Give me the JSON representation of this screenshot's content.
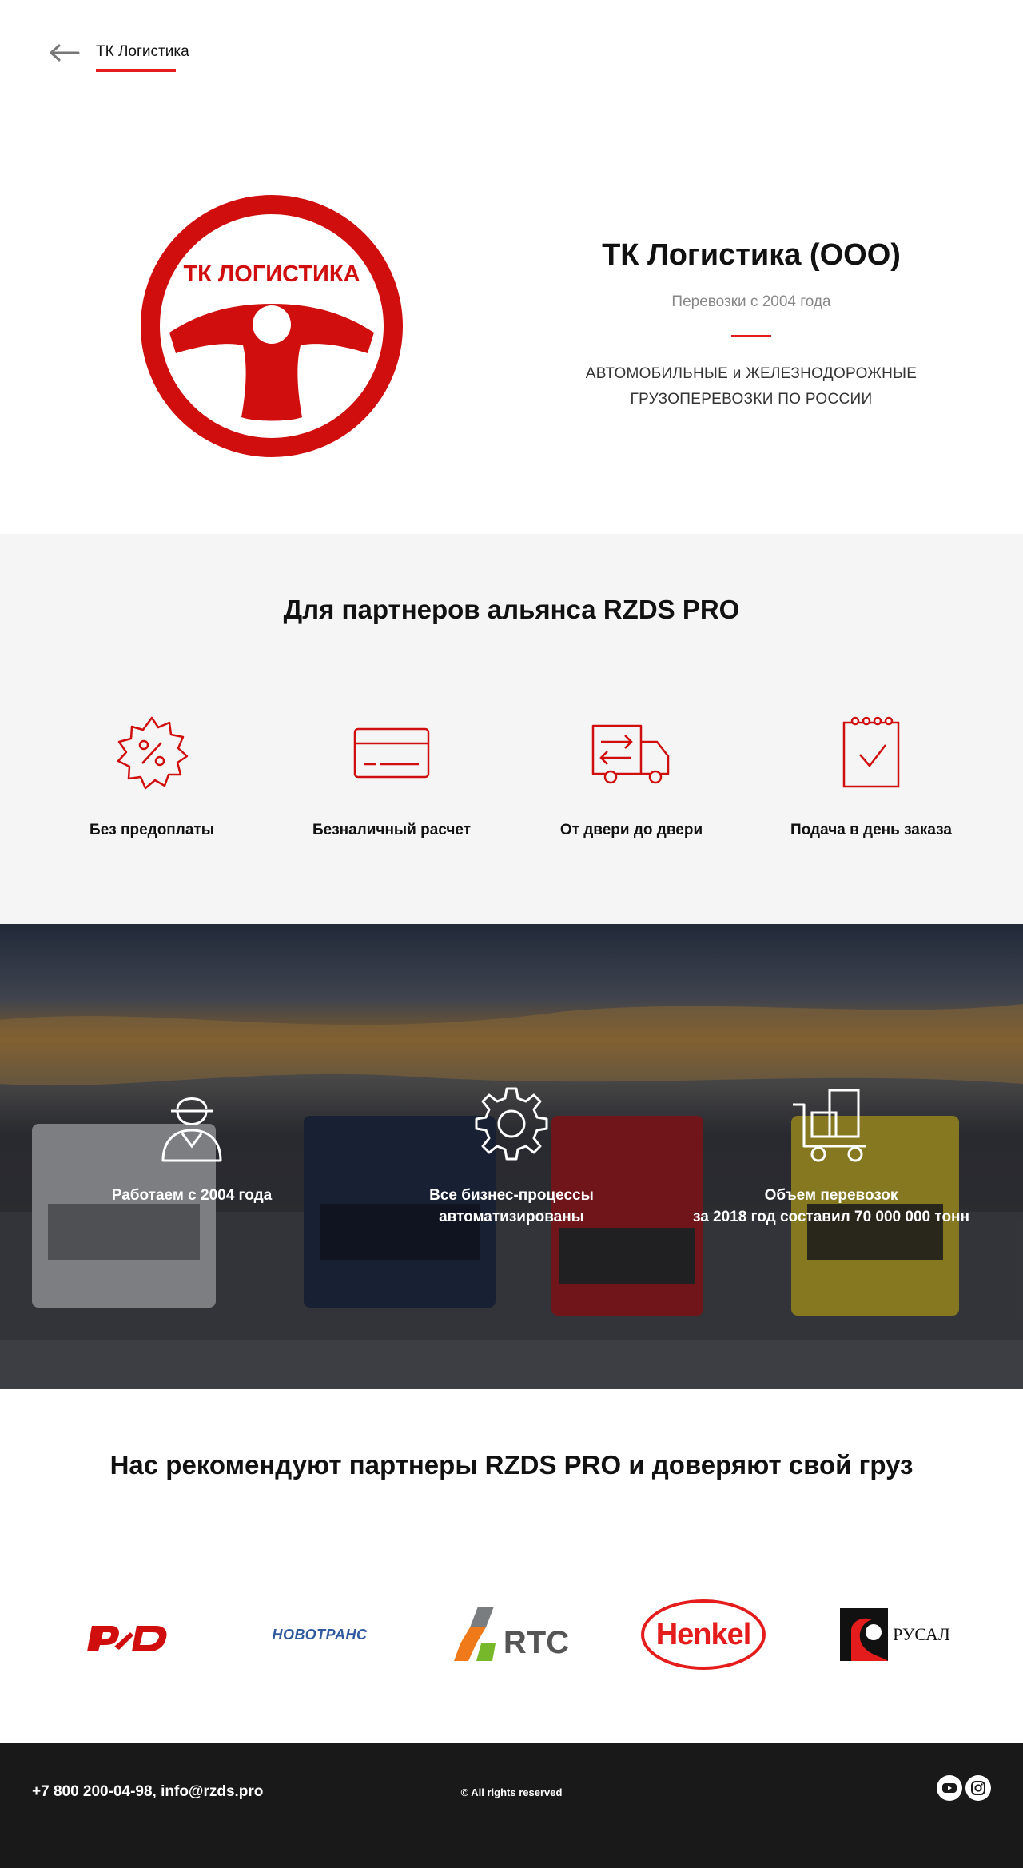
{
  "header": {
    "back_link": "ТК Логистика"
  },
  "hero": {
    "logo_text": "ТК ЛОГИСТИКА",
    "company_name": "ТК Логистика (ООО)",
    "since": "Перевозки с 2004 года",
    "services_line1": "АВТОМОБИЛЬНЫЕ и ЖЕЛЕЗНОДОРОЖНЫЕ",
    "services_line2": "ГРУЗОПЕРЕВОЗКИ ПО РОССИИ"
  },
  "features": {
    "title": "Для партнеров альянса RZDS PRO",
    "items": [
      {
        "label": "Без предоплаты",
        "icon": "discount-badge-icon"
      },
      {
        "label": "Безналичный расчет",
        "icon": "credit-card-icon"
      },
      {
        "label": "От двери до двери",
        "icon": "delivery-truck-icon"
      },
      {
        "label": "Подача в день заказа",
        "icon": "calendar-check-icon"
      }
    ]
  },
  "stats": {
    "items": [
      {
        "line1": "Работаем с 2004 года",
        "line2": "",
        "icon": "worker-icon"
      },
      {
        "line1": "Все бизнес-процессы",
        "line2": "автоматизированы",
        "icon": "gear-icon"
      },
      {
        "line1": "Объем перевозок",
        "line2": "за 2018 год составил 70 000 000 тонн",
        "icon": "cargo-cart-icon"
      }
    ]
  },
  "recommend": {
    "title": "Нас рекомендуют партнеры RZDS PRO и доверяют свой груз",
    "partners": [
      {
        "name": "РЖД",
        "text": ""
      },
      {
        "name": "Новотранс",
        "text": "НОВОТРАНС"
      },
      {
        "name": "RTC",
        "text": "RTC"
      },
      {
        "name": "Henkel",
        "text": "Henkel"
      },
      {
        "name": "Русал",
        "text": "РУСАЛ"
      }
    ]
  },
  "footer": {
    "contacts": "+7 800 200-04-98, info@rzds.pro",
    "rights": "© All rights reserved",
    "social": [
      {
        "icon": "youtube-icon"
      },
      {
        "icon": "instagram-icon"
      }
    ]
  },
  "colors": {
    "accent": "#e41c1c",
    "logo_red": "#d10e0e",
    "footer_bg": "#191919",
    "section_bg": "#f5f5f5"
  }
}
